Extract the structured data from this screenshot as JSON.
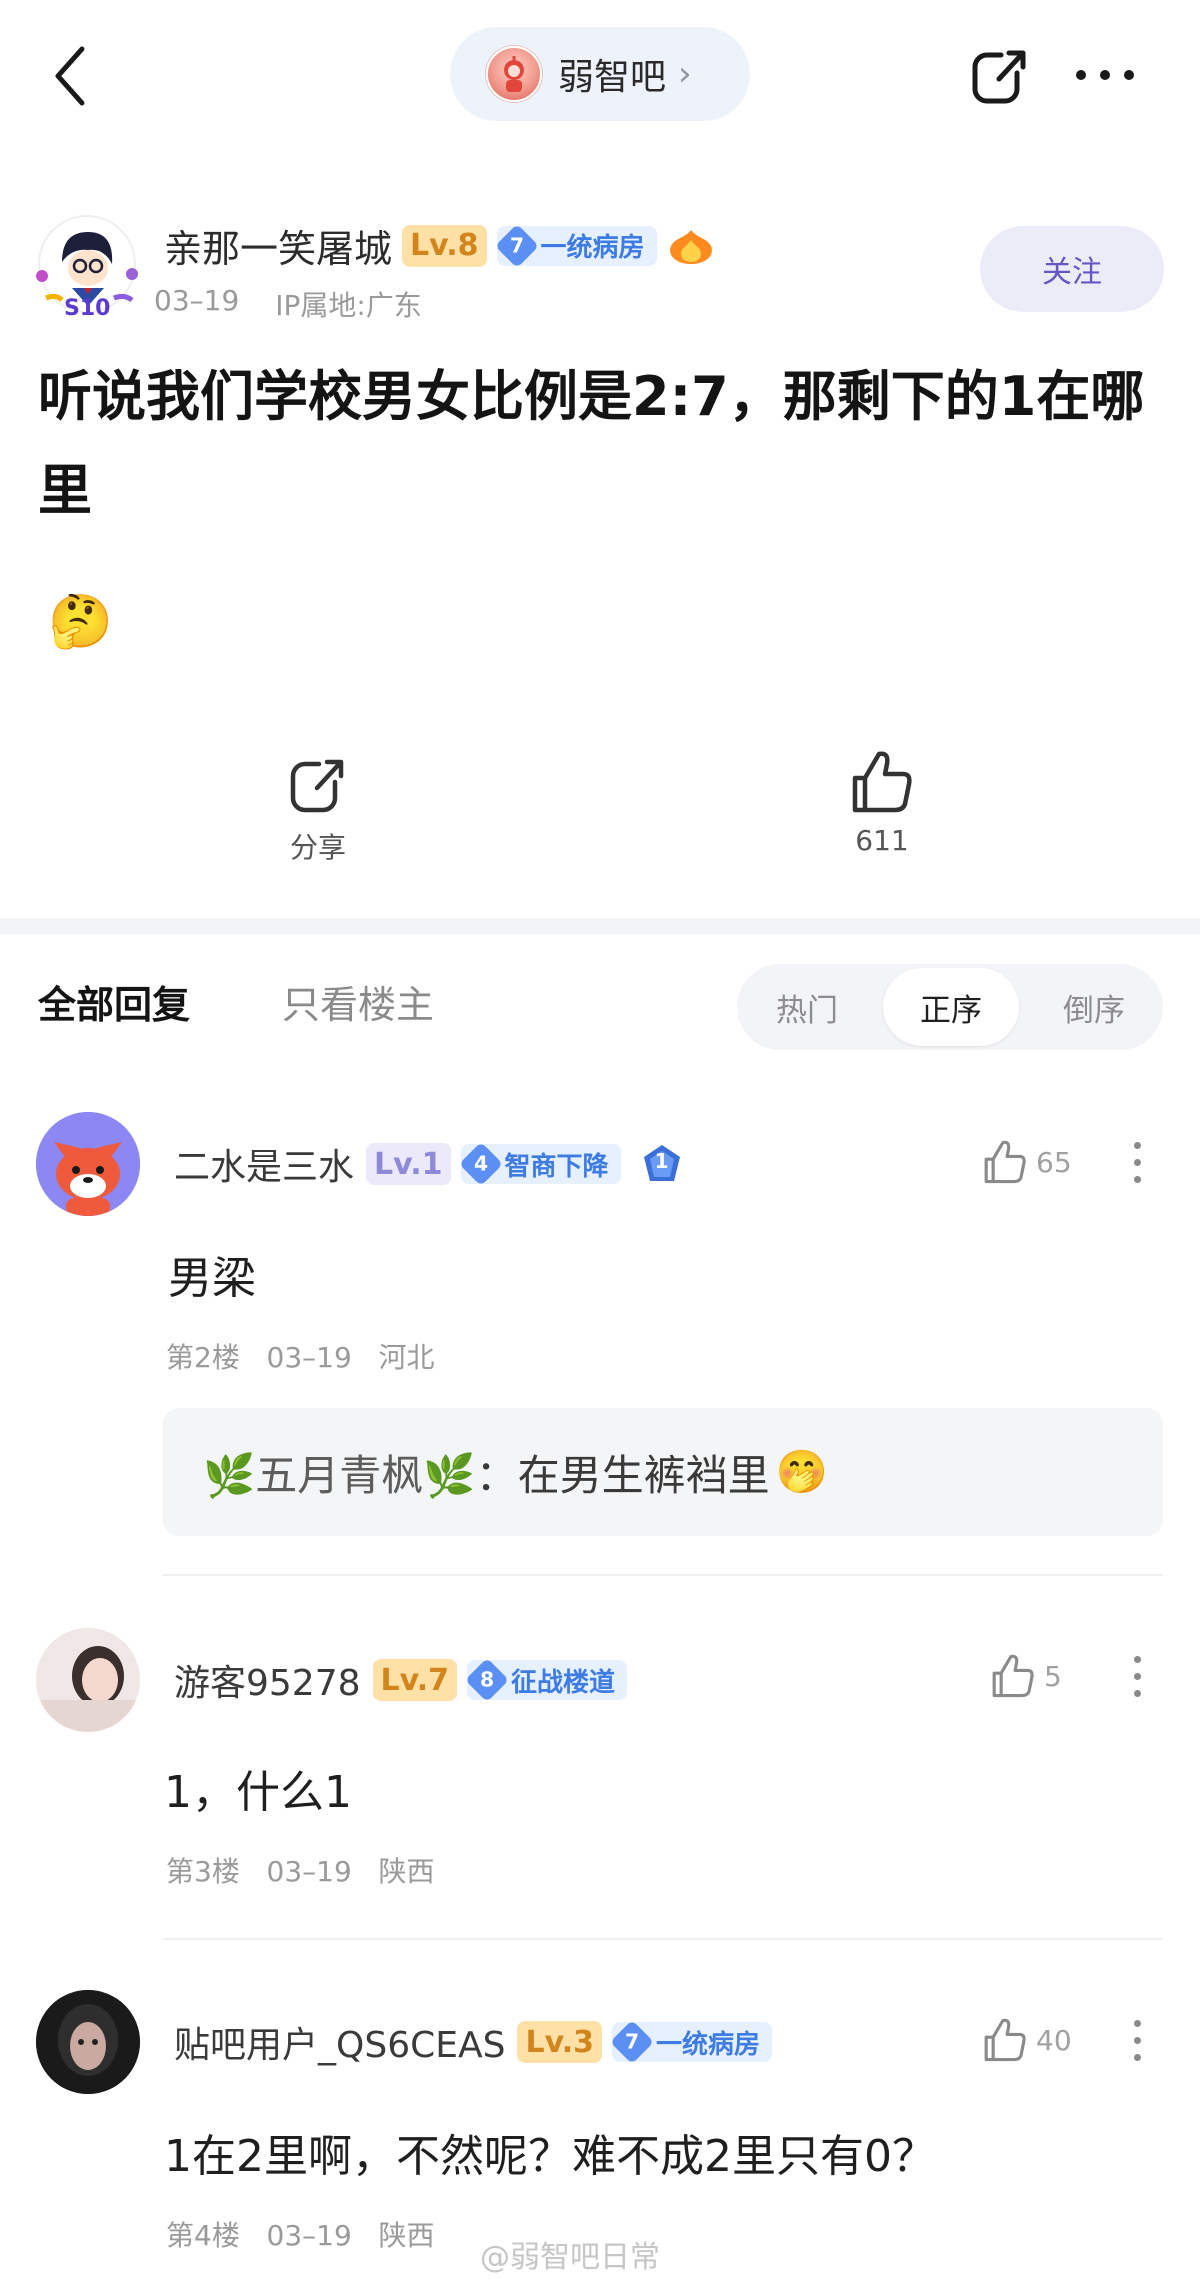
{
  "topbar": {
    "forum_name": "弱智吧",
    "chevron": "›"
  },
  "post": {
    "author": "亲那一笑屠城",
    "level": "Lv.8",
    "rank_num": "7",
    "rank_title": "一统病房",
    "avatar_badge": "S10",
    "date": "03–19",
    "ip": "IP属地:广东",
    "follow_label": "关注",
    "title": "听说我们学校男女比例是2:7，那剩下的1在哪里",
    "emoji": "🤔",
    "share_label": "分享",
    "like_count": "611"
  },
  "tabs": {
    "all_replies": "全部回复",
    "op_only": "只看楼主",
    "sort": [
      "热门",
      "正序",
      "倒序"
    ],
    "active_sort_index": 1
  },
  "comments": [
    {
      "user": "二水是三水",
      "level": "Lv.1",
      "rank_num": "4",
      "rank_title": "智商下降",
      "badge": "1",
      "likes": "65",
      "body": "男梁",
      "meta": "第2楼   03–19   河北",
      "reply_user": "🌿五月青枫🌿",
      "reply_text": "：在男生裤裆里",
      "reply_emoji": "🤭"
    },
    {
      "user": "游客95278",
      "level": "Lv.7",
      "rank_num": "8",
      "rank_title": "征战楼道",
      "likes": "5",
      "body": "1，什么1",
      "meta": "第3楼   03–19   陕西"
    },
    {
      "user": "贴吧用户_QS6CEAS",
      "level": "Lv.3",
      "rank_num": "7",
      "rank_title": "一统病房",
      "likes": "40",
      "body": "1在2里啊，不然呢？难不成2里只有0？",
      "meta": "第4楼   03–19   陕西"
    }
  ],
  "watermark": "@弱智吧日常",
  "colors": {
    "accent_blue": "#3e7be3",
    "follow_text": "#6457c4",
    "level_orange": "#d1851c"
  }
}
